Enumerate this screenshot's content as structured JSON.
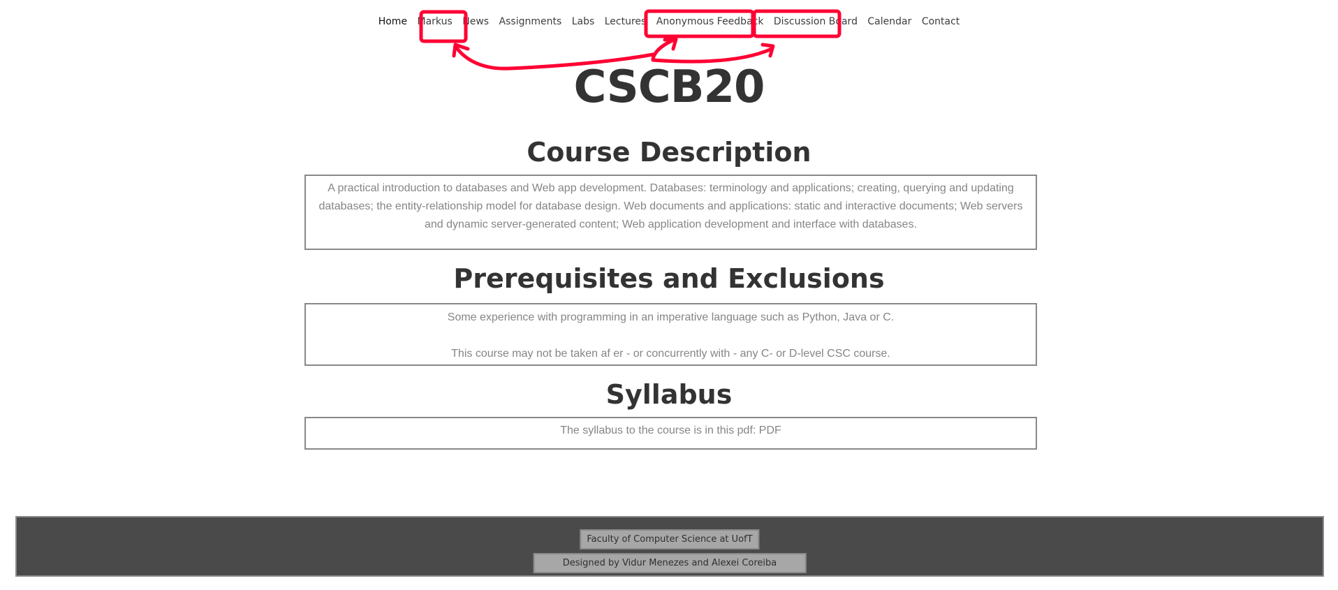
{
  "nav": {
    "items": [
      {
        "label": "Home"
      },
      {
        "label": "Markus"
      },
      {
        "label": "News"
      },
      {
        "label": "Assignments"
      },
      {
        "label": "Labs"
      },
      {
        "label": "Lectures"
      },
      {
        "label": "Anonymous Feedback"
      },
      {
        "label": "Discussion Board"
      },
      {
        "label": "Calendar"
      },
      {
        "label": "Contact"
      }
    ]
  },
  "site": {
    "title": "CSCB20"
  },
  "sections": {
    "description": {
      "heading": "Course Description",
      "text": "A practical introduction to databases and Web app development. Databases: terminology and applications; creating, querying and updating databases; the entity-relationship model for database design. Web documents and applications: static and interactive documents; Web servers and dynamic server-generated content; Web application development and interface with databases."
    },
    "prereq": {
      "heading": "Prerequisites and Exclusions",
      "line1": "Some experience with programming in an imperative language such as Python, Java or C.",
      "line2": "This course may not be taken af er - or concurrently with - any C- or D-level CSC course."
    },
    "syllabus": {
      "heading": "Syllabus",
      "text": "The syllabus to the course is in this pdf: PDF"
    }
  },
  "footer": {
    "line1": "Faculty of Computer Science at UofT",
    "line2": "Designed by Vidur Menezes and Alexei Coreiba"
  },
  "colors": {
    "annotation": "#ff0033",
    "footer_bg": "#4a4a4a",
    "heading": "#333333",
    "body_text": "#858585"
  }
}
